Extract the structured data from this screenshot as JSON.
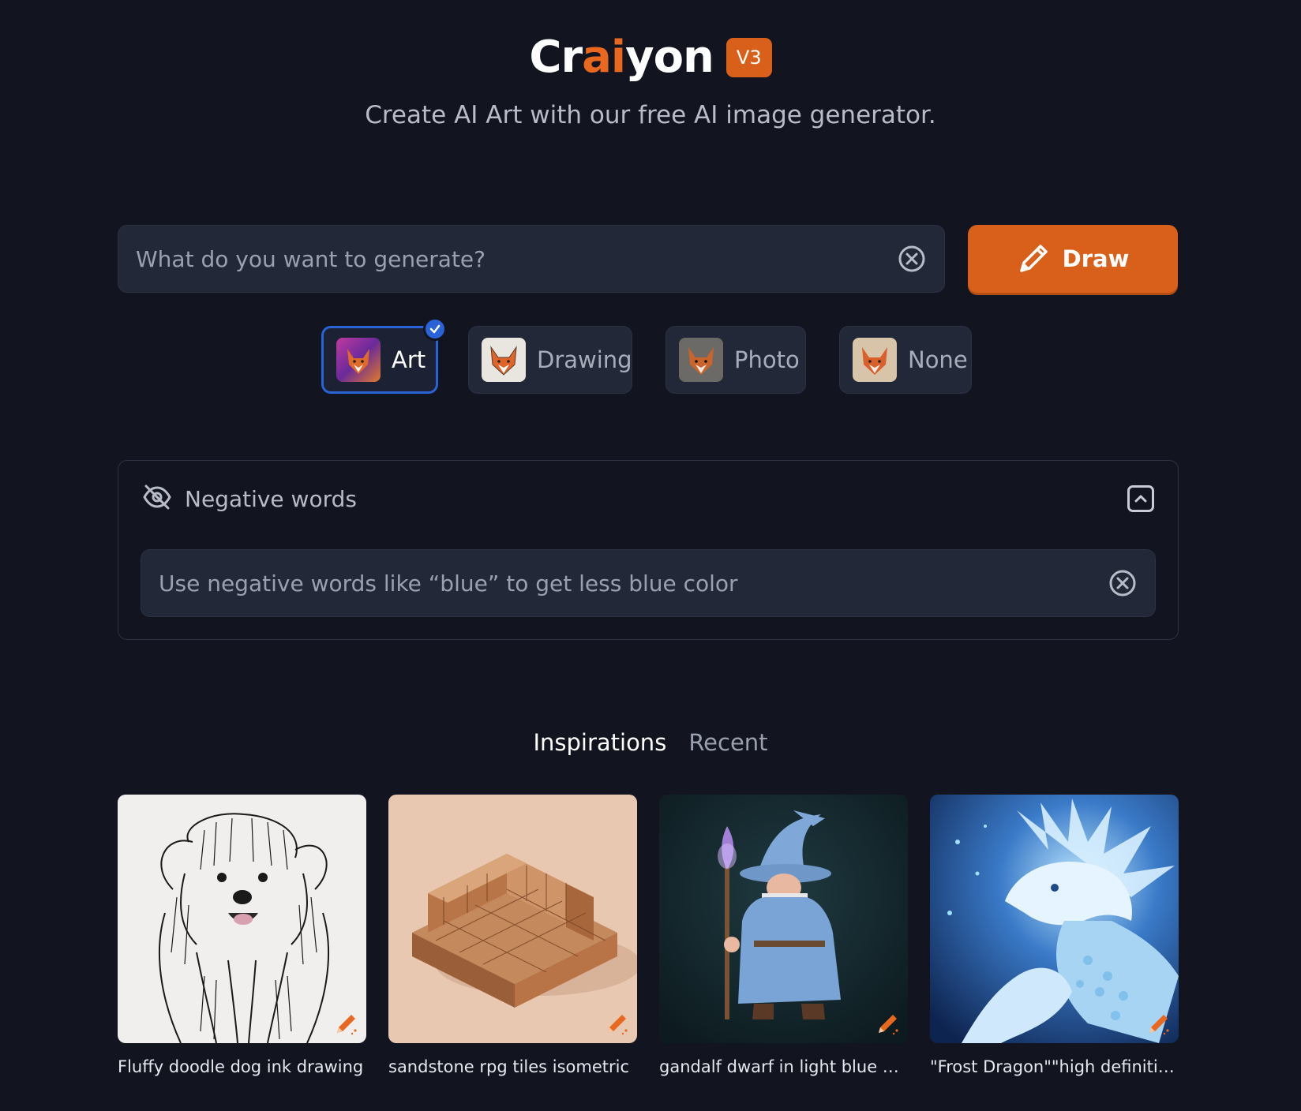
{
  "header": {
    "logo_text_1": "Cr",
    "logo_text_hl": "ai",
    "logo_text_2": "yon",
    "version": "V3",
    "tagline": "Create AI Art with our free AI image generator."
  },
  "prompt": {
    "placeholder": "What do you want to generate?",
    "value": "",
    "clear_icon": "close-circle-icon",
    "draw_label": "Draw",
    "draw_icon": "pencil-icon"
  },
  "styles": [
    {
      "label": "Art",
      "selected": true
    },
    {
      "label": "Drawing",
      "selected": false
    },
    {
      "label": "Photo",
      "selected": false
    },
    {
      "label": "None",
      "selected": false
    }
  ],
  "negative": {
    "title": "Negative words",
    "icon": "eye-off-icon",
    "collapse_icon": "chevron-up-icon",
    "placeholder": "Use negative words like “blue” to get less blue color",
    "value": ""
  },
  "tabs": {
    "inspirations": "Inspirations",
    "recent": "Recent",
    "active": "Inspirations"
  },
  "gallery": [
    {
      "caption": "Fluffy doodle dog ink drawing"
    },
    {
      "caption": "sandstone rpg tiles isometric"
    },
    {
      "caption": "gandalf dwarf in light blue and..."
    },
    {
      "caption": "\"Frost Dragon\"\"high definition\""
    }
  ],
  "colors": {
    "background": "#121520",
    "accent": "#d9601a",
    "selected_border": "#2a63d8",
    "field_bg": "#222838"
  }
}
